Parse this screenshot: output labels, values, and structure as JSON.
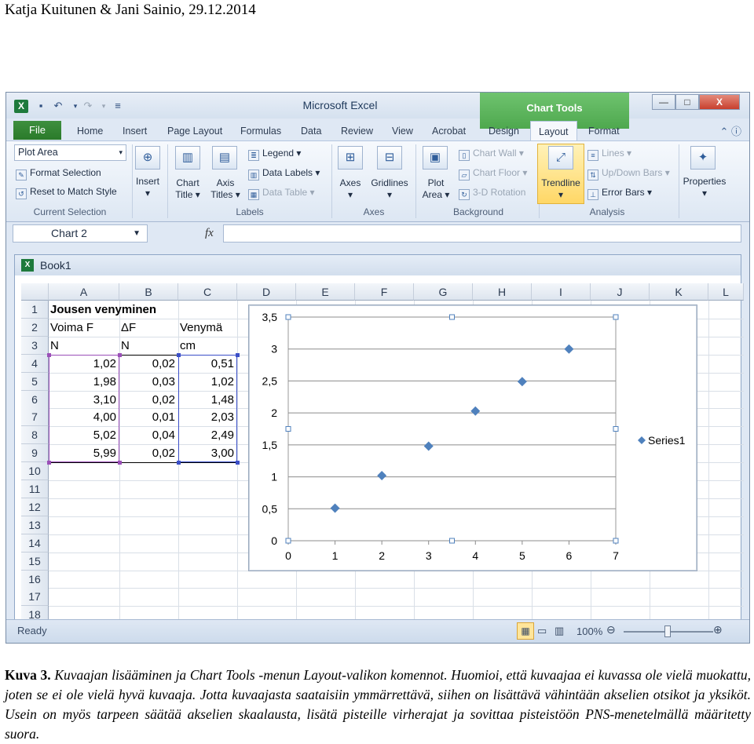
{
  "doc": {
    "header": "Katja Kuitunen & Jani Sainio, 29.12.2014",
    "caption_label": "Kuva 3.",
    "caption_text": "Kuvaajan lisääminen ja Chart Tools -menun Layout-valikon komennot. Huomioi, että kuvaajaa ei kuvassa ole vielä muokattu, joten se ei ole vielä hyvä kuvaaja. Jotta kuvaajasta saataisiin ymmärrettävä, siihen on lisättävä vähintään akselien otsikot ja yksiköt. Usein on myös tarpeen säätää akselien skaalausta, lisätä pisteille virherajat ja sovittaa pisteistöön PNS-menetelmällä määritetty suora."
  },
  "window": {
    "title": "Microsoft Excel",
    "context_tab": "Chart Tools",
    "controls": {
      "minimize": "—",
      "maximize": "□",
      "close": "X"
    }
  },
  "tabs": {
    "file": "File",
    "items": [
      "Home",
      "Insert",
      "Page Layout",
      "Formulas",
      "Data",
      "Review",
      "View",
      "Acrobat",
      "Design",
      "Layout",
      "Format"
    ],
    "active": "Layout"
  },
  "ribbon": {
    "current_selection": {
      "combo": "Plot Area",
      "format_selection": "Format Selection",
      "reset": "Reset to Match Style",
      "label": "Current Selection"
    },
    "insert": {
      "label": "Insert"
    },
    "labels": {
      "chart_title_1": "Chart",
      "chart_title_2": "Title",
      "axis_titles_1": "Axis",
      "axis_titles_2": "Titles",
      "legend": "Legend",
      "data_labels": "Data Labels",
      "data_table": "Data Table",
      "label": "Labels"
    },
    "axes": {
      "axes": "Axes",
      "gridlines": "Gridlines",
      "label": "Axes"
    },
    "background": {
      "plot_area_1": "Plot",
      "plot_area_2": "Area",
      "chart_wall": "Chart Wall",
      "chart_floor": "Chart Floor",
      "rotation": "3-D Rotation",
      "label": "Background"
    },
    "analysis": {
      "trendline": "Trendline",
      "lines": "Lines",
      "updown": "Up/Down Bars",
      "error_bars": "Error Bars",
      "label": "Analysis"
    },
    "properties": "Properties"
  },
  "formula_bar": {
    "name_box": "Chart 2",
    "fx": "fx",
    "formula": ""
  },
  "workbook": {
    "title": "Book1",
    "columns": [
      "A",
      "B",
      "C",
      "D",
      "E",
      "F",
      "G",
      "H",
      "I",
      "J",
      "K",
      "L"
    ],
    "rows": [
      "1",
      "2",
      "3",
      "4",
      "5",
      "6",
      "7",
      "8",
      "9",
      "10",
      "11",
      "12",
      "13",
      "14",
      "15",
      "16",
      "17",
      "18"
    ],
    "a1": "Jousen venyminen",
    "headers": [
      "Voima F",
      "ΔF",
      "Venymä"
    ],
    "units": [
      "N",
      "N",
      "cm"
    ],
    "data": [
      [
        "1,02",
        "0,02",
        "0,51"
      ],
      [
        "1,98",
        "0,03",
        "1,02"
      ],
      [
        "3,10",
        "0,02",
        "1,48"
      ],
      [
        "4,00",
        "0,01",
        "2,03"
      ],
      [
        "5,02",
        "0,04",
        "2,49"
      ],
      [
        "5,99",
        "0,02",
        "3,00"
      ]
    ]
  },
  "status": {
    "ready": "Ready",
    "zoom": "100%"
  },
  "chart_data": {
    "type": "scatter",
    "series": [
      {
        "name": "Series1",
        "x": [
          1,
          2,
          3,
          4,
          5,
          6
        ],
        "y": [
          0.51,
          1.02,
          1.48,
          2.03,
          2.49,
          3.0
        ]
      }
    ],
    "x_ticks": [
      "0",
      "1",
      "2",
      "3",
      "4",
      "5",
      "6",
      "7"
    ],
    "y_ticks": [
      "0",
      "0,5",
      "1",
      "1,5",
      "2",
      "2,5",
      "3",
      "3,5"
    ],
    "xlim": [
      0,
      7
    ],
    "ylim": [
      0,
      3.5
    ],
    "grid": "horizontal",
    "legend": "right",
    "color": "#4f81bd"
  }
}
